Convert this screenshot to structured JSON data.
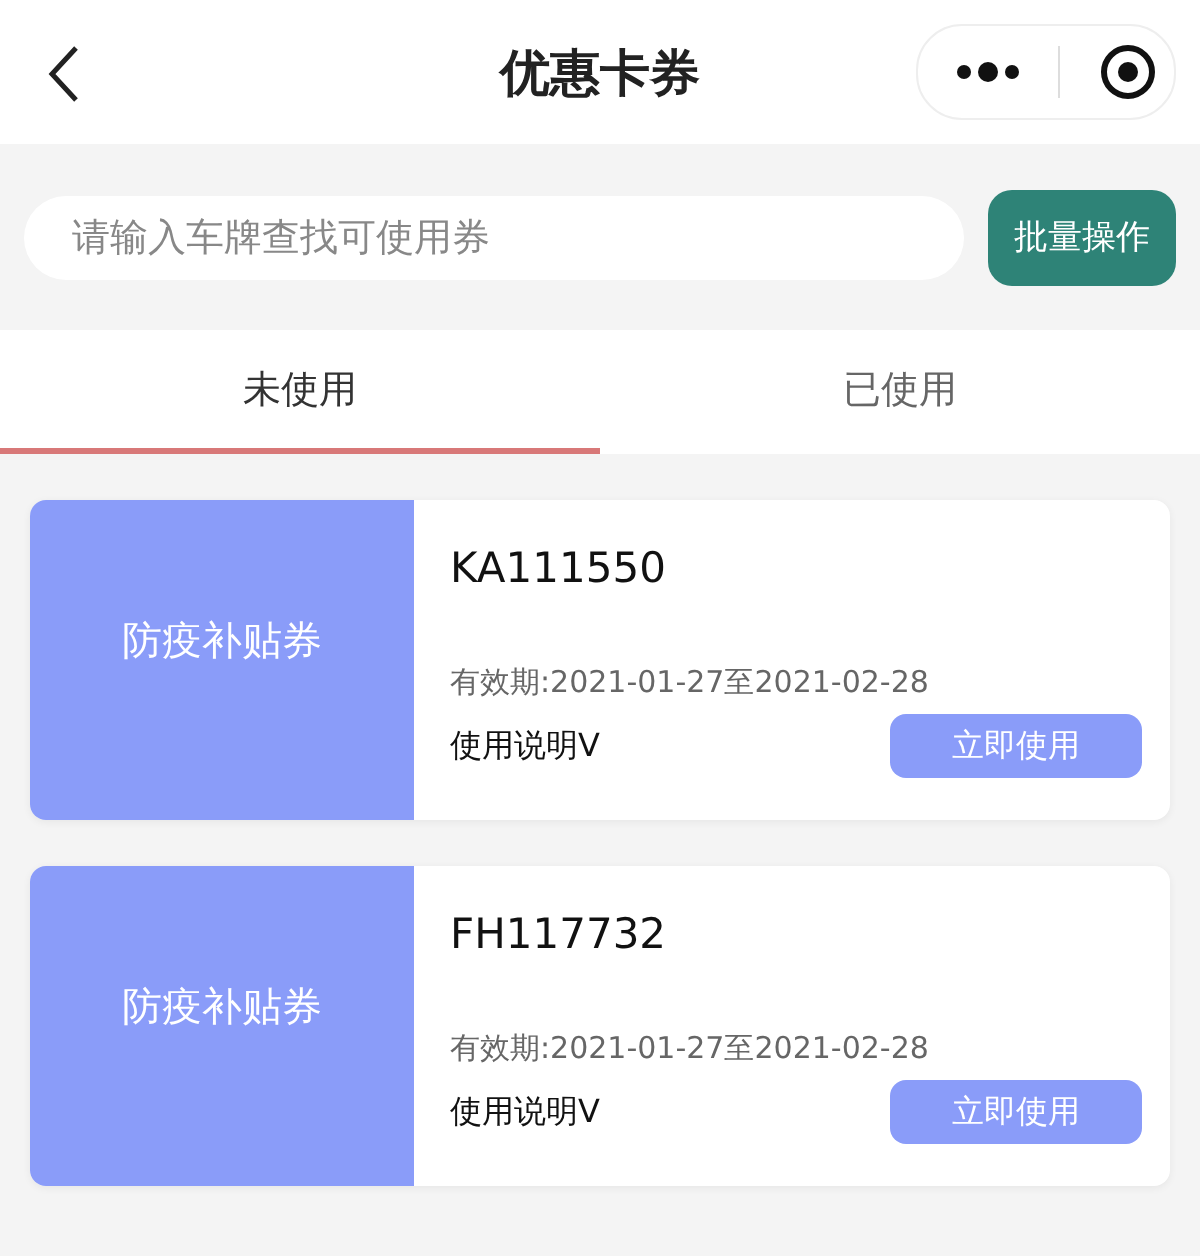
{
  "header": {
    "title": "优惠卡券"
  },
  "search": {
    "placeholder": "请输入车牌查找可使用券",
    "button": "批量操作"
  },
  "tabs": [
    {
      "label": "未使用",
      "selected": true
    },
    {
      "label": "已使用",
      "selected": false
    }
  ],
  "coupons": [
    {
      "name": "防疫补贴券",
      "plate": "KA111550",
      "validity": "有效期:2021-01-27至2021-02-28",
      "instructions": "使用说明V",
      "action": "立即使用"
    },
    {
      "name": "防疫补贴券",
      "plate": "FH117732",
      "validity": "有效期:2021-01-27至2021-02-28",
      "instructions": "使用说明V",
      "action": "立即使用"
    }
  ]
}
